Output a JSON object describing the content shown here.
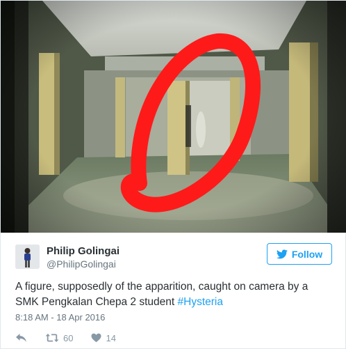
{
  "tweet": {
    "display_name": "Philip Golingai",
    "handle": "@PhilipGolingai",
    "follow_label": "Follow",
    "text_main": "A figure, supposedly of the apparition, caught on camera by a\nSMK Pengkalan Chepa 2 student ",
    "hashtag": "#Hysteria",
    "timestamp": "8:18 AM - 18 Apr 2016",
    "retweet_count": "60",
    "like_count": "14"
  },
  "colors": {
    "accent": "#1da1f2",
    "text": "#292f33",
    "muted": "#66757f",
    "action_icons": "#8899a6",
    "circle_marking": "#ff1a1a"
  },
  "icons": {
    "follow": "twitter-bird-icon",
    "reply": "reply-icon",
    "retweet": "retweet-icon",
    "like": "heart-icon"
  }
}
